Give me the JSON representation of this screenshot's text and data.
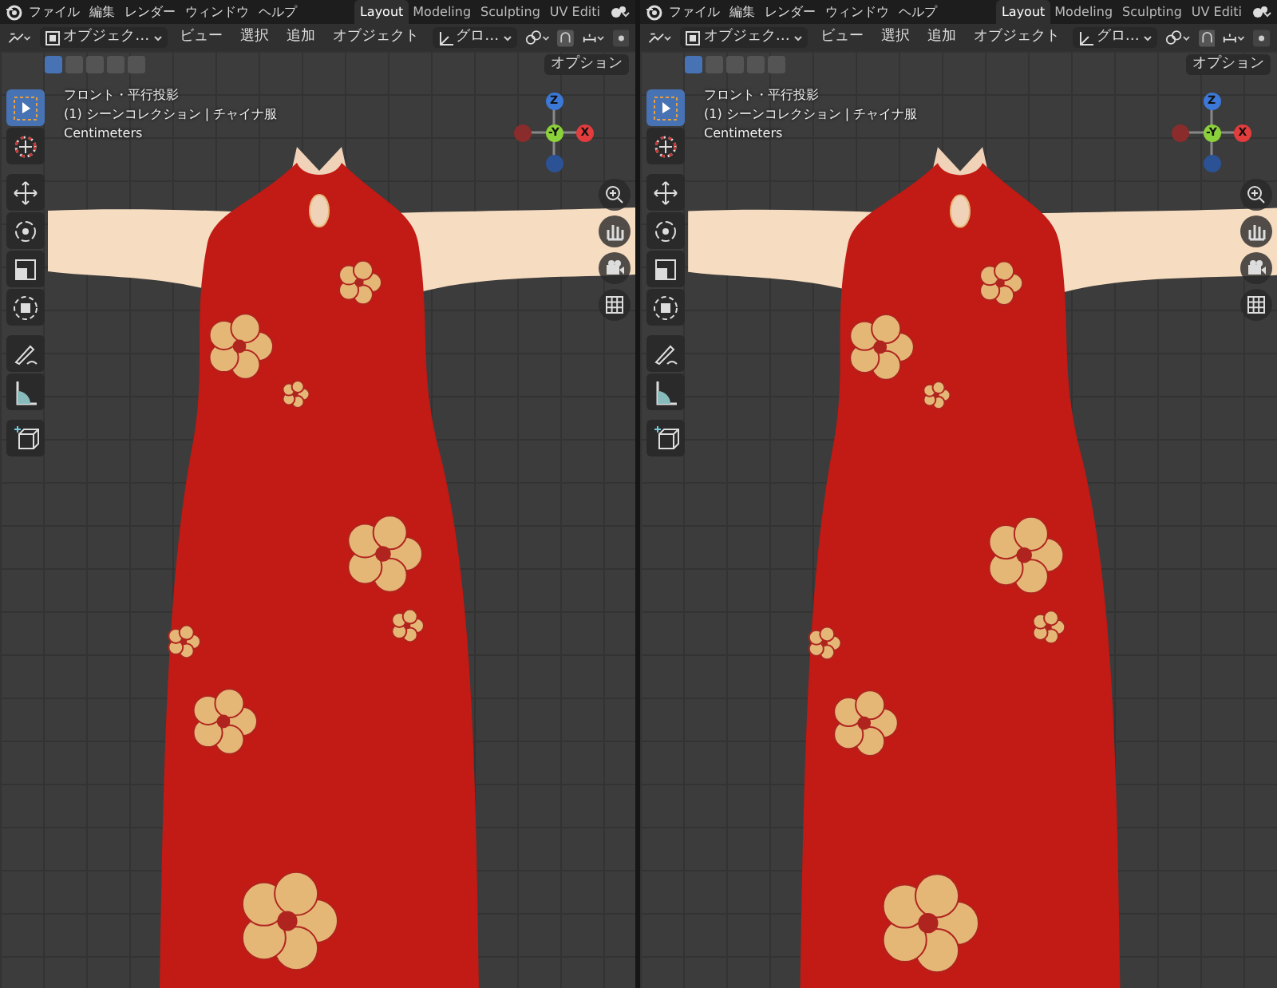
{
  "panes": [
    {
      "menu": [
        "ファイル",
        "編集",
        "レンダー",
        "ウィンドウ",
        "ヘルプ"
      ],
      "workspaces": [
        {
          "label": "Layout",
          "selected": true
        },
        {
          "label": "Modeling",
          "selected": false
        },
        {
          "label": "Sculpting",
          "selected": false
        },
        {
          "label": "UV Editi",
          "selected": false
        }
      ],
      "mode": "オブジェク…",
      "header_menu": [
        "ビュー",
        "選択",
        "追加",
        "オブジェクト"
      ],
      "orientation": "グロ…",
      "select_modes": [
        {
          "selected": true
        },
        {
          "selected": false
        },
        {
          "selected": false
        },
        {
          "selected": false
        },
        {
          "selected": false
        }
      ],
      "options": "オプション",
      "overlay": [
        "フロント・平行投影",
        "(1) シーンコレクション | チャイナ服",
        "Centimeters"
      ],
      "gizmo": {
        "z": "Z",
        "y": "-Y",
        "x": "X"
      },
      "tools": [
        {
          "kind": "select",
          "selected": true
        },
        {
          "kind": "cursor",
          "selected": false
        },
        {
          "kind": "move",
          "selected": false
        },
        {
          "kind": "rotate",
          "selected": false
        },
        {
          "kind": "scale",
          "selected": false
        },
        {
          "kind": "transform",
          "selected": false
        },
        {
          "kind": "annotate",
          "selected": false
        },
        {
          "kind": "measure",
          "selected": false
        },
        {
          "kind": "add",
          "selected": false
        }
      ]
    },
    {
      "menu": [
        "ファイル",
        "編集",
        "レンダー",
        "ウィンドウ",
        "ヘルプ"
      ],
      "workspaces": [
        {
          "label": "Layout",
          "selected": true
        },
        {
          "label": "Modeling",
          "selected": false
        },
        {
          "label": "Sculpting",
          "selected": false
        },
        {
          "label": "UV Editi",
          "selected": false
        }
      ],
      "mode": "オブジェク…",
      "header_menu": [
        "ビュー",
        "選択",
        "追加",
        "オブジェクト"
      ],
      "orientation": "グロ…",
      "select_modes": [
        {
          "selected": true
        },
        {
          "selected": false
        },
        {
          "selected": false
        },
        {
          "selected": false
        },
        {
          "selected": false
        }
      ],
      "options": "オプション",
      "overlay": [
        "フロント・平行投影",
        "(1) シーンコレクション | チャイナ服",
        "Centimeters"
      ],
      "gizmo": {
        "z": "Z",
        "y": "-Y",
        "x": "X"
      },
      "tools": [
        {
          "kind": "select",
          "selected": true
        },
        {
          "kind": "cursor",
          "selected": false
        },
        {
          "kind": "move",
          "selected": false
        },
        {
          "kind": "rotate",
          "selected": false
        },
        {
          "kind": "scale",
          "selected": false
        },
        {
          "kind": "transform",
          "selected": false
        },
        {
          "kind": "annotate",
          "selected": false
        },
        {
          "kind": "measure",
          "selected": false
        },
        {
          "kind": "add",
          "selected": false
        }
      ]
    }
  ]
}
